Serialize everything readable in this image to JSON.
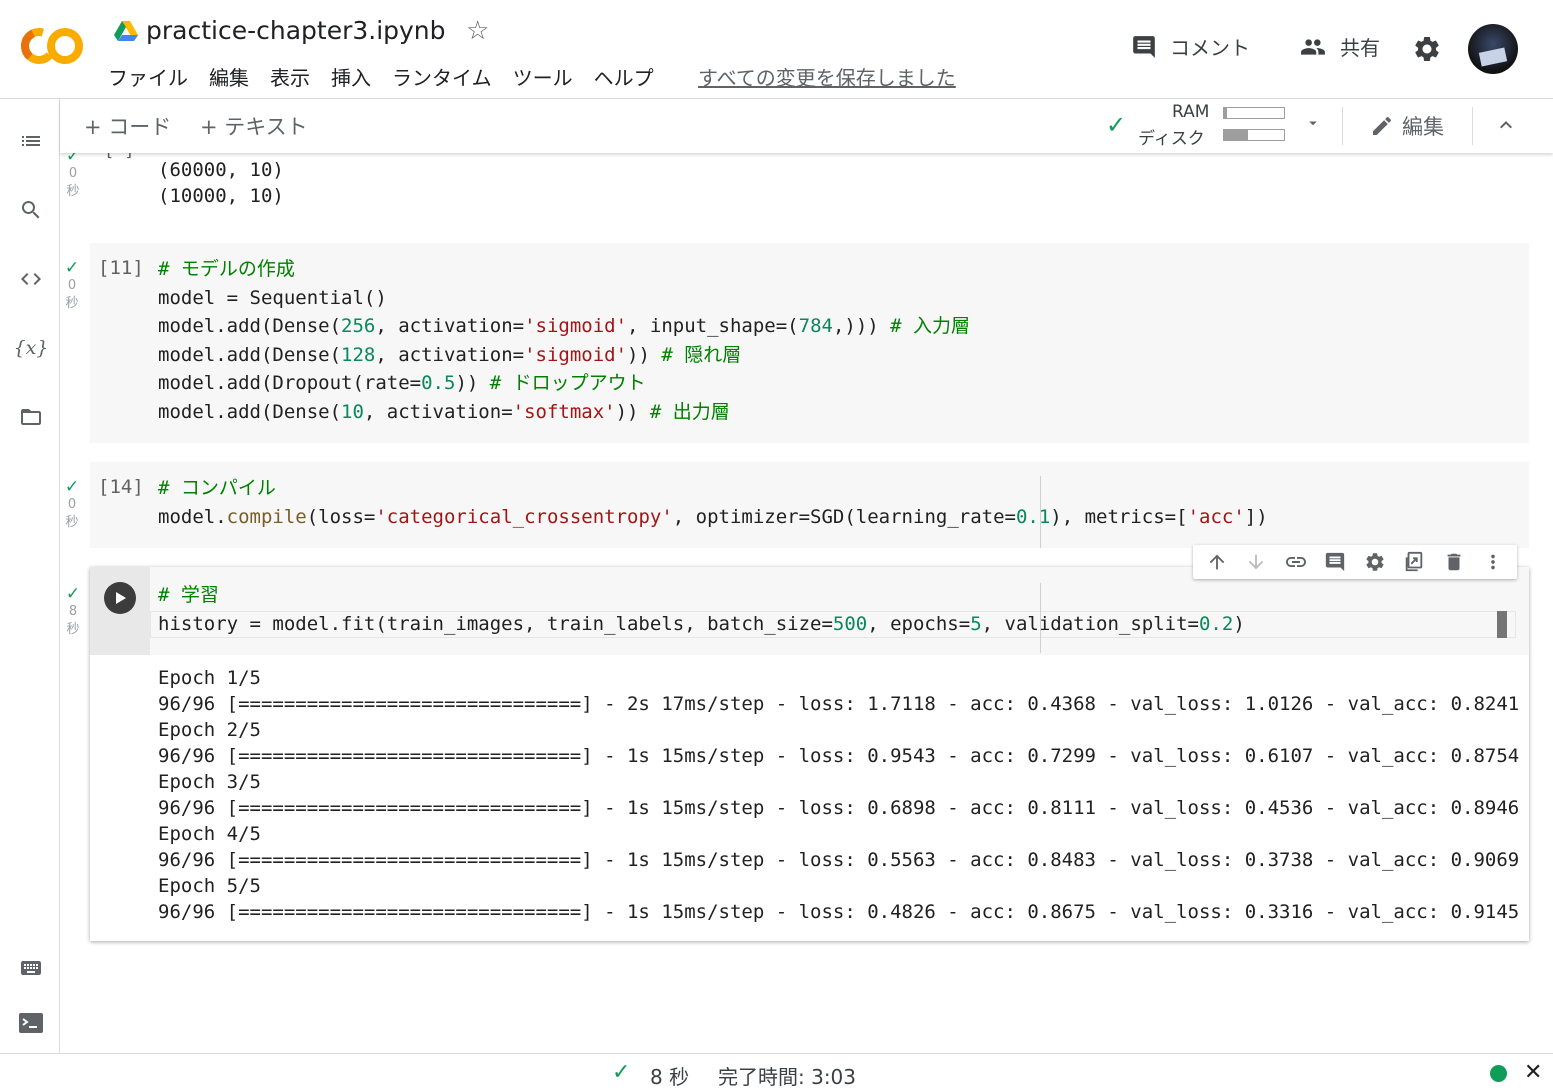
{
  "header": {
    "title": "practice-chapter3.ipynb",
    "menu": [
      "ファイル",
      "編集",
      "表示",
      "挿入",
      "ランタイム",
      "ツール",
      "ヘルプ"
    ],
    "saved_status": "すべての変更を保存しました",
    "comment_label": "コメント",
    "share_label": "共有"
  },
  "toolbar": {
    "add_code": "+ コード",
    "add_text": "+ テキスト",
    "ram_label": "RAM",
    "disk_label": "ディスク",
    "ram_usage": 0.05,
    "disk_usage": 0.4,
    "edit_label": "編集"
  },
  "cells": [
    {
      "duration_value": "0",
      "duration_unit": "秒",
      "output": "(60000, 10)\n(10000, 10)"
    },
    {
      "exec": "[11]",
      "duration_value": "0",
      "duration_unit": "秒",
      "lines": [
        "# モデルの作成",
        "model = Sequential()",
        "model.add(Dense(256, activation='sigmoid', input_shape=(784,))) # 入力層",
        "model.add(Dense(128, activation='sigmoid')) # 隠れ層",
        "model.add(Dropout(rate=0.5)) # ドロップアウト",
        "model.add(Dense(10, activation='softmax')) # 出力層"
      ]
    },
    {
      "exec": "[14]",
      "duration_value": "0",
      "duration_unit": "秒",
      "lines": [
        "# コンパイル",
        "model.compile(loss='categorical_crossentropy', optimizer=SGD(learning_rate=0.1), metrics=['acc'])"
      ]
    },
    {
      "duration_value": "8",
      "duration_unit": "秒",
      "lines": [
        "# 学習",
        "history = model.fit(train_images, train_labels, batch_size=500, epochs=5, validation_split=0.2)"
      ],
      "output": "Epoch 1/5\n96/96 [==============================] - 2s 17ms/step - loss: 1.7118 - acc: 0.4368 - val_loss: 1.0126 - val_acc: 0.8241\nEpoch 2/5\n96/96 [==============================] - 1s 15ms/step - loss: 0.9543 - acc: 0.7299 - val_loss: 0.6107 - val_acc: 0.8754\nEpoch 3/5\n96/96 [==============================] - 1s 15ms/step - loss: 0.6898 - acc: 0.8111 - val_loss: 0.4536 - val_acc: 0.8946\nEpoch 4/5\n96/96 [==============================] - 1s 15ms/step - loss: 0.5563 - acc: 0.8483 - val_loss: 0.3738 - val_acc: 0.9069\nEpoch 5/5\n96/96 [==============================] - 1s 15ms/step - loss: 0.4826 - acc: 0.8675 - val_loss: 0.3316 - val_acc: 0.9145"
    }
  ],
  "statusbar": {
    "duration": "8 秒",
    "completed": "完了時間: 3:03"
  },
  "colors": {
    "accent_green": "#0f9d58",
    "comment": "#008000",
    "string": "#a31515",
    "number": "#09885a",
    "function": "#795e26"
  },
  "icons": {
    "sidebar": [
      "toc-icon",
      "search-icon",
      "code-snippets-icon",
      "variables-icon",
      "files-icon",
      "command-palette-icon",
      "terminal-icon"
    ],
    "cell_toolbar": [
      "move-up-icon",
      "move-down-icon",
      "link-icon",
      "comment-icon",
      "cell-settings-icon",
      "mirror-cell-icon",
      "delete-icon",
      "more-icon"
    ]
  }
}
